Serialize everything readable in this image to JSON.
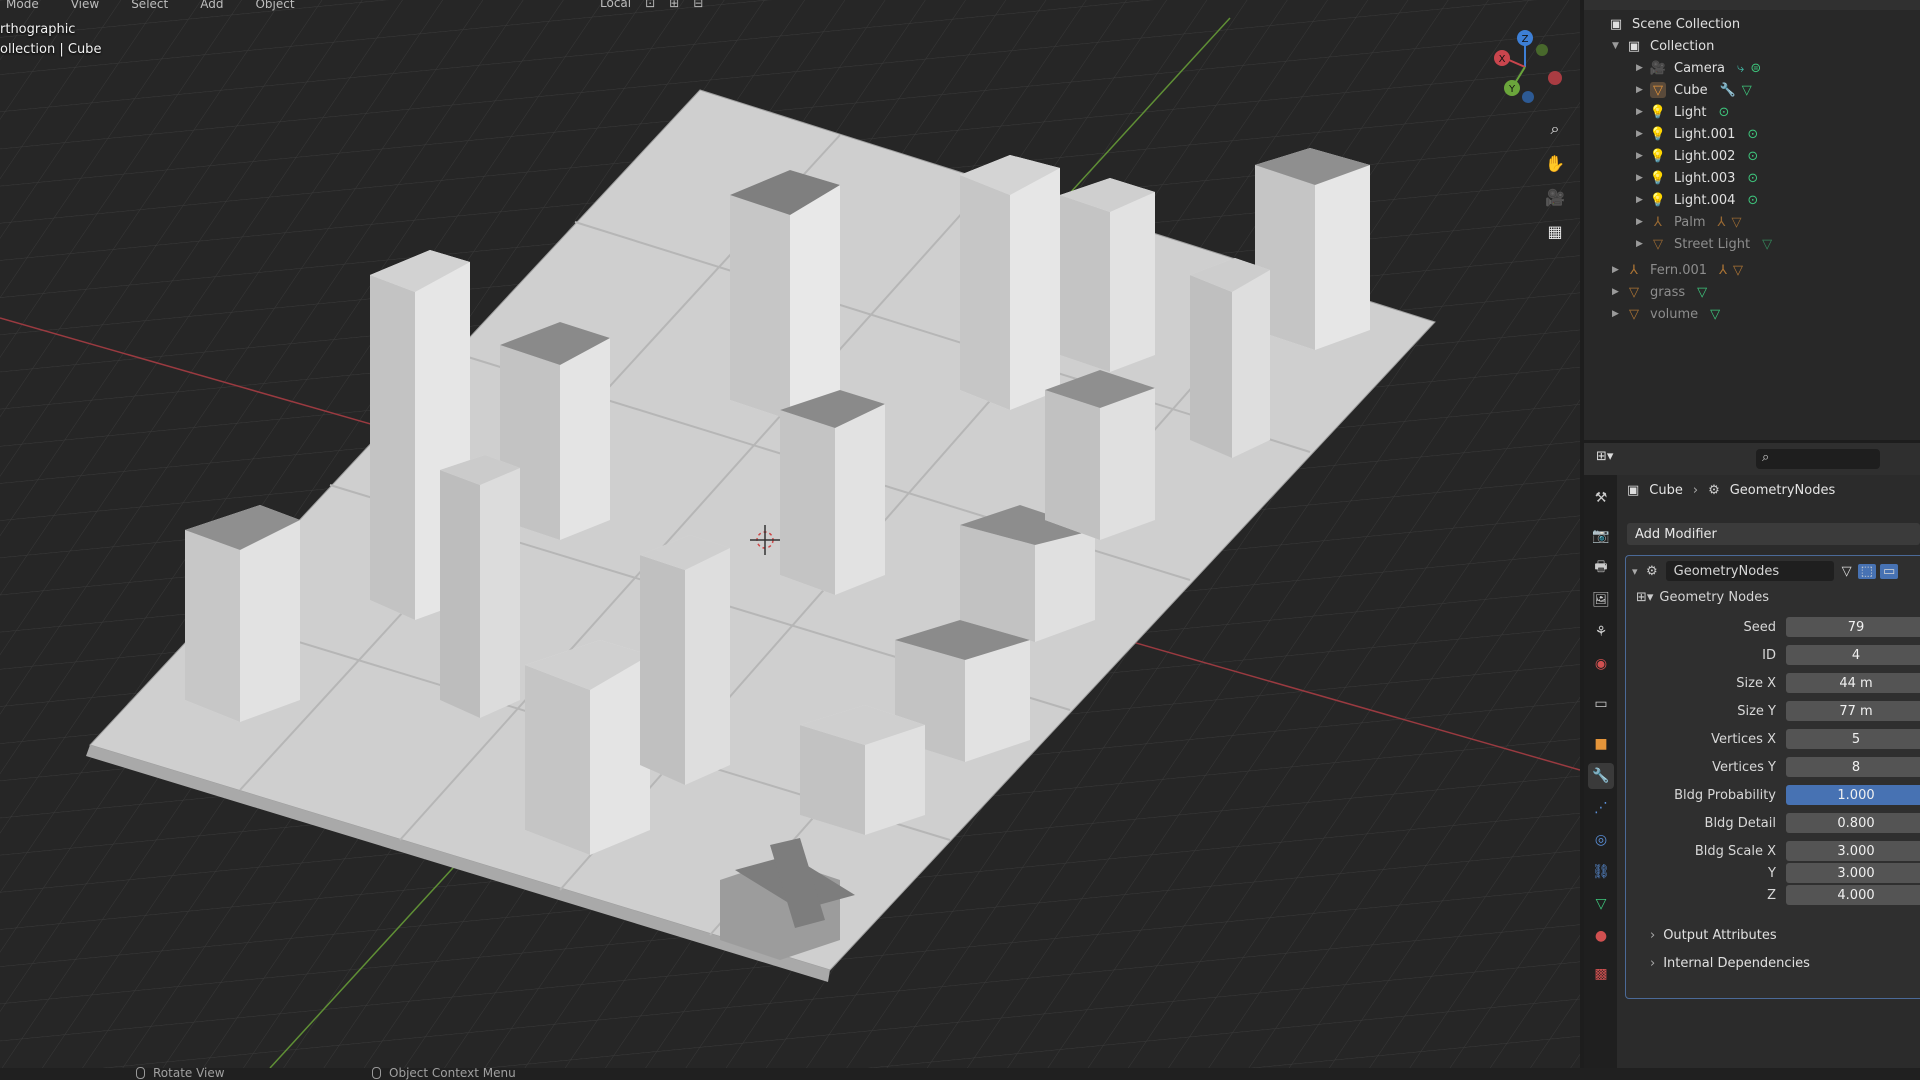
{
  "viewport": {
    "menu": [
      "Mode",
      "View",
      "Select",
      "Add",
      "Object"
    ],
    "header_center": [
      "Local",
      "⊡",
      "⊞",
      "⊟"
    ],
    "overlay_line1": "rthographic",
    "overlay_line2": "ollection | Cube",
    "gizmo": {
      "x": "X",
      "y": "Y",
      "z": "Z"
    },
    "nav_tools": [
      "zoom-icon",
      "hand-icon",
      "camera-icon",
      "grid-icon"
    ]
  },
  "statusbar": {
    "left_action": "Rotate View",
    "right_action": "Object Context Menu"
  },
  "outliner": {
    "root": "Scene Collection",
    "collection": "Collection",
    "items": [
      {
        "name": "Camera",
        "icon": "camera-icon",
        "dim": false
      },
      {
        "name": "Cube",
        "icon": "mesh-icon",
        "dim": false
      },
      {
        "name": "Light",
        "icon": "light-icon",
        "dim": false
      },
      {
        "name": "Light.001",
        "icon": "light-icon",
        "dim": false
      },
      {
        "name": "Light.002",
        "icon": "light-icon",
        "dim": false
      },
      {
        "name": "Light.003",
        "icon": "light-icon",
        "dim": false
      },
      {
        "name": "Light.004",
        "icon": "light-icon",
        "dim": false
      },
      {
        "name": "Palm",
        "icon": "armature-icon",
        "dim": true
      },
      {
        "name": "Street Light",
        "icon": "mesh-icon",
        "dim": true
      }
    ],
    "root_items": [
      {
        "name": "Fern.001",
        "icon": "armature-icon"
      },
      {
        "name": "grass",
        "icon": "mesh-icon"
      },
      {
        "name": "volume",
        "icon": "mesh-icon"
      }
    ]
  },
  "properties": {
    "breadcrumb_object": "Cube",
    "breadcrumb_modifier": "GeometryNodes",
    "add_modifier": "Add Modifier",
    "modifier_name": "GeometryNodes",
    "node_group": "Geometry Nodes",
    "fields": [
      {
        "label": "Seed",
        "value": "79",
        "highlight": false
      },
      {
        "label": "ID",
        "value": "4",
        "highlight": false
      },
      {
        "label": "Size X",
        "value": "44 m",
        "highlight": false
      },
      {
        "label": "Size Y",
        "value": "77 m",
        "highlight": false
      },
      {
        "label": "Vertices X",
        "value": "5",
        "highlight": false
      },
      {
        "label": "Vertices Y",
        "value": "8",
        "highlight": false
      },
      {
        "label": "Bldg Probability",
        "value": "1.000",
        "highlight": true
      },
      {
        "label": "Bldg Detail",
        "value": "0.800",
        "highlight": false
      },
      {
        "label": "Bldg Scale X",
        "value": "3.000",
        "highlight": false
      },
      {
        "label": "Y",
        "value": "3.000",
        "highlight": false
      },
      {
        "label": "Z",
        "value": "4.000",
        "highlight": false
      }
    ],
    "sub_panels": [
      "Output Attributes",
      "Internal Dependencies"
    ]
  },
  "colors": {
    "accent_blue": "#4772b3",
    "x_axis": "#c9454d",
    "y_axis": "#6aa53b",
    "z_axis": "#3d7fd6"
  }
}
